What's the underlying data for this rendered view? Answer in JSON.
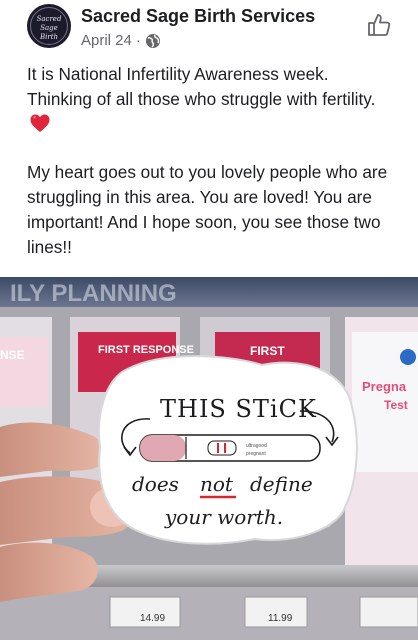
{
  "post": {
    "author": "Sacred Sage Birth Services",
    "date": "April 24",
    "separator": "·",
    "privacy_icon": "globe-icon",
    "like_icon": "thumbs-up-icon",
    "avatar_text": [
      "Sacred Sage",
      "Birth"
    ],
    "paragraph1": "It is National Infertility Awareness week. Thinking of all those who struggle with fertility.",
    "paragraph1_emoji": "red-heart",
    "paragraph2": "My heart goes out to you lovely people who are struggling in this area. You are loved! You are important! And I hope soon, you see those two lines!!"
  },
  "photo": {
    "sticker_line1": "THIS STiCK",
    "sticker_line2a": "does",
    "sticker_line2b": "not",
    "sticker_line2c": "define",
    "sticker_line3": "your worth.",
    "stick_small_text_1": "ultragood",
    "stick_small_text_2": "pregnant",
    "box_labels": [
      "FIRST RESPONSE",
      "FIRST",
      "Pregna",
      "Test",
      "NSE"
    ],
    "price_tags": [
      "11.99",
      "14.99"
    ],
    "colors": {
      "accent_red": "#d8262b",
      "sticker_pink": "#e1a8b4"
    }
  }
}
